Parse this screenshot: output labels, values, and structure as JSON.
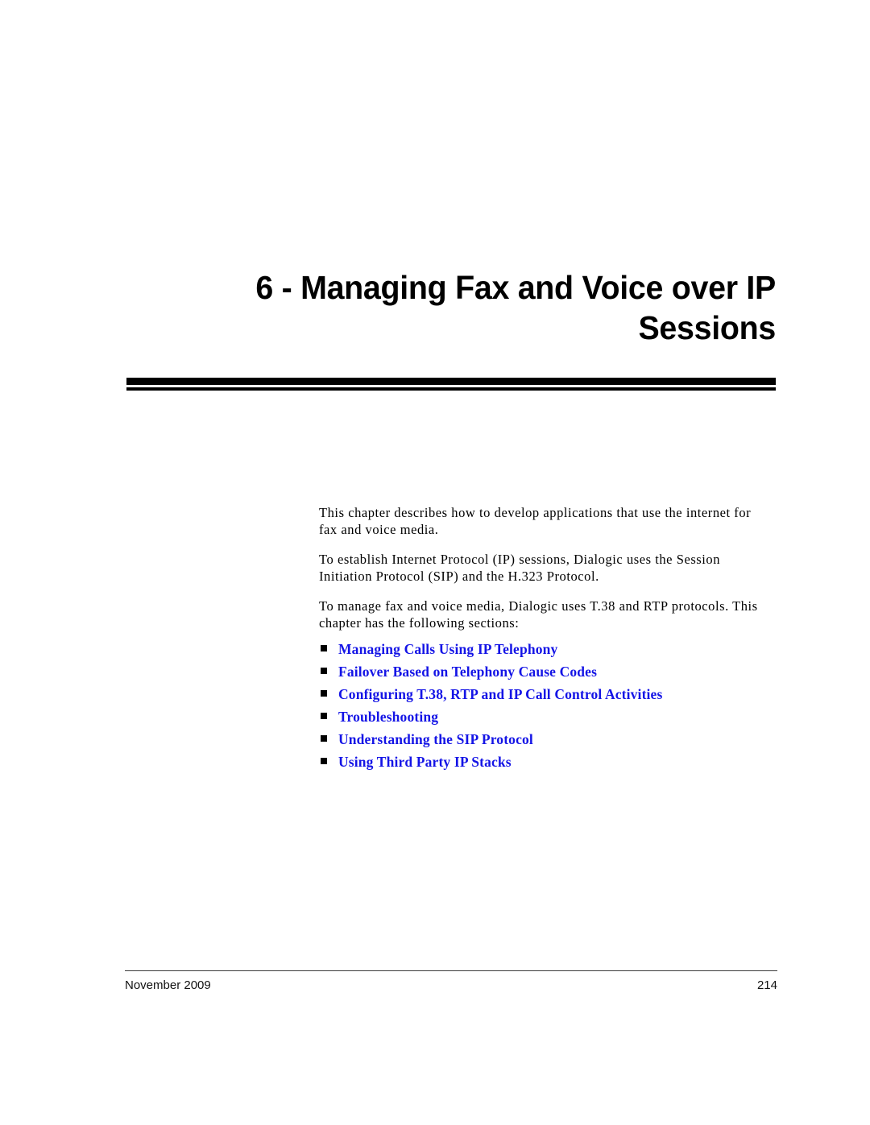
{
  "document": {
    "chapter_title": "6 - Managing Fax and Voice over IP Sessions",
    "title_line_1": "6 - Managing Fax and Voice over IP",
    "title_line_2": "Sessions"
  },
  "body": {
    "paragraphs": [
      "This chapter describes how to develop applications that use the internet for fax and voice media.",
      "To establish Internet Protocol (IP) sessions, Dialogic uses the Session Initiation Protocol (SIP) and the H.323 Protocol.",
      "To manage fax and voice media, Dialogic uses T.38 and RTP protocols. This chapter has the following sections:"
    ]
  },
  "sections": {
    "bullet_glyph": "square-bullet-icon",
    "link_color": "#1414e6",
    "items": [
      {
        "label": "Managing Calls Using IP Telephony"
      },
      {
        "label": "Failover Based on Telephony Cause Codes"
      },
      {
        "label": "Configuring T.38, RTP and IP Call Control Activities"
      },
      {
        "label": "Troubleshooting"
      },
      {
        "label": "Understanding the SIP Protocol"
      },
      {
        "label": "Using Third Party IP Stacks"
      }
    ]
  },
  "footer": {
    "date": "November 2009",
    "page_number": "214"
  }
}
